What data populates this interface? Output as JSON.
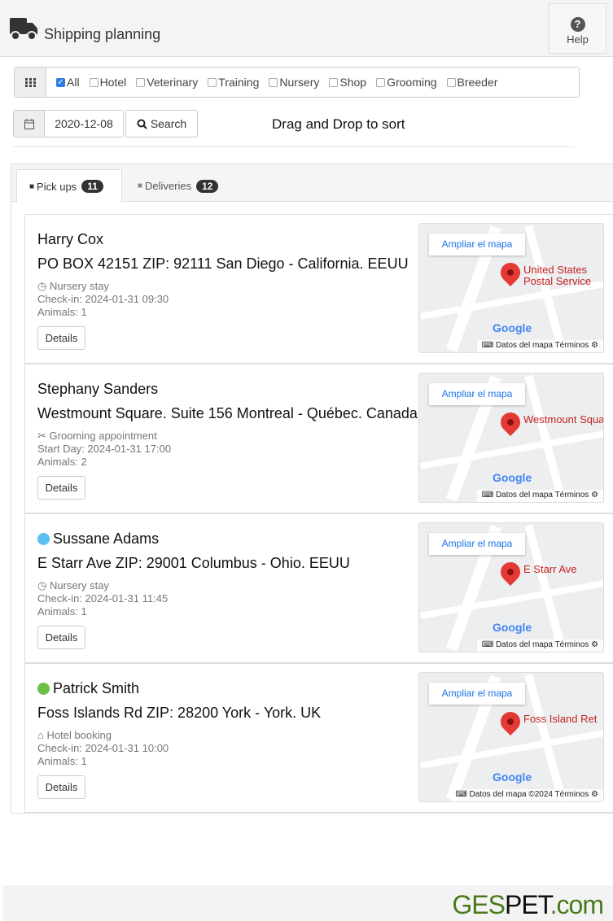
{
  "header": {
    "title": "Shipping planning",
    "help_label": "Help",
    "icon": "truck-icon"
  },
  "filters": {
    "items": [
      {
        "label": "All",
        "checked": true
      },
      {
        "label": "Hotel",
        "checked": false
      },
      {
        "label": "Veterinary",
        "checked": false
      },
      {
        "label": "Training",
        "checked": false
      },
      {
        "label": "Nursery",
        "checked": false
      },
      {
        "label": "Shop",
        "checked": false
      },
      {
        "label": "Grooming",
        "checked": false
      },
      {
        "label": "Breeder",
        "checked": false
      }
    ]
  },
  "date": {
    "value": "2020-12-08"
  },
  "search_label": "Search",
  "hint": "Drag and Drop to sort",
  "tabs": [
    {
      "label": "Pick ups",
      "count": "11",
      "active": true
    },
    {
      "label": "Deliveries",
      "count": "12",
      "active": false
    }
  ],
  "cards": [
    {
      "name": "Harry Cox",
      "dot": null,
      "address": "PO BOX 42151 ZIP: 92111 San Diego - California. EEUU",
      "service": "Nursery stay",
      "service_icon": "clock-icon",
      "date_line": "Check-in: 2024-01-31 09:30",
      "animals": "Animals: 1",
      "details": "Details",
      "map": {
        "expand": "Ampliar el mapa",
        "place": "United States\nPostal Service",
        "attribution": "Datos del mapa   Términos"
      }
    },
    {
      "name": "Stephany Sanders",
      "dot": null,
      "address": "Westmount Square. Suite 156 Montreal - Québec. Canada",
      "service": "Grooming appointment",
      "service_icon": "scissors-icon",
      "date_line": "Start Day: 2024-01-31 17:00",
      "animals": "Animals: 2",
      "details": "Details",
      "map": {
        "expand": "Ampliar el mapa",
        "place": "Westmount Squa",
        "attribution": "Datos del mapa   Términos"
      }
    },
    {
      "name": "Sussane Adams",
      "dot": "#5bc0f0",
      "address": "E Starr Ave ZIP: 29001 Columbus - Ohio. EEUU",
      "service": "Nursery stay",
      "service_icon": "clock-icon",
      "date_line": "Check-in: 2024-01-31 11:45",
      "animals": "Animals: 1",
      "details": "Details",
      "map": {
        "expand": "Ampliar el mapa",
        "place": "E Starr Ave",
        "attribution": "Datos del mapa   Términos"
      }
    },
    {
      "name": "Patrick Smith",
      "dot": "#6cc04a",
      "address": "Foss Islands Rd ZIP: 28200 York - York. UK",
      "service": "Hotel booking",
      "service_icon": "home-icon",
      "date_line": "Check-in: 2024-01-31 10:00",
      "animals": "Animals: 1",
      "details": "Details",
      "map": {
        "expand": "Ampliar el mapa",
        "place": "Foss Island Ret",
        "attribution": "Datos del mapa ©2024   Términos"
      }
    }
  ],
  "map_brand": "Google",
  "footer": {
    "logo_a": "GES",
    "logo_b": "PET",
    "logo_c": ".com"
  }
}
